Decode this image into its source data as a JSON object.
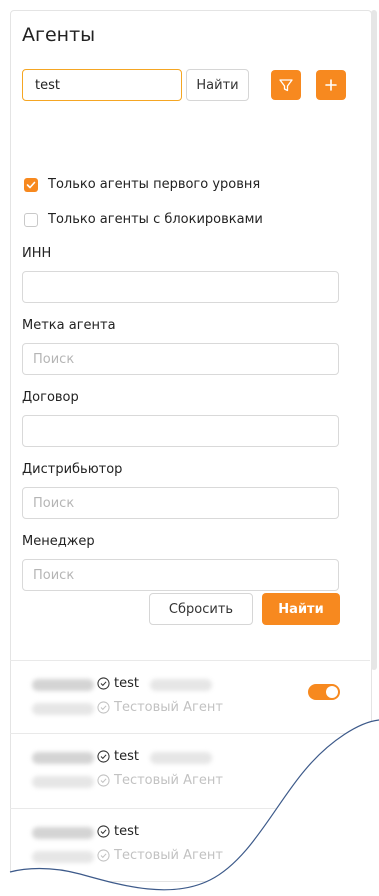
{
  "title": "Агенты",
  "search": {
    "value": "test",
    "button": "Найти"
  },
  "filters": {
    "first_level": {
      "label": "Только агенты первого уровня",
      "checked": true
    },
    "blocked": {
      "label": "Только агенты с блокировками",
      "checked": false
    },
    "inn": {
      "label": "ИНН",
      "value": "",
      "placeholder": ""
    },
    "tag": {
      "label": "Метка агента",
      "placeholder": "Поиск"
    },
    "contract": {
      "label": "Договор",
      "value": "",
      "placeholder": ""
    },
    "distributor": {
      "label": "Дистрибьютор",
      "placeholder": "Поиск"
    },
    "manager": {
      "label": "Менеджер",
      "placeholder": "Поиск"
    },
    "reset_label": "Сбросить",
    "find_label": "Найти"
  },
  "agents": [
    {
      "name": "test",
      "type": "Тестовый Агент",
      "toggle_on": true
    },
    {
      "name": "test",
      "type": "Тестовый Агент"
    },
    {
      "name": "test",
      "type": "Тестовый Агент"
    }
  ],
  "colors": {
    "accent": "#f7891f",
    "search_border": "#f5a623",
    "annotation": "#3d5a8a"
  },
  "icons": {
    "filter": "filter-icon",
    "add": "plus-icon",
    "check": "check-circle-icon"
  }
}
